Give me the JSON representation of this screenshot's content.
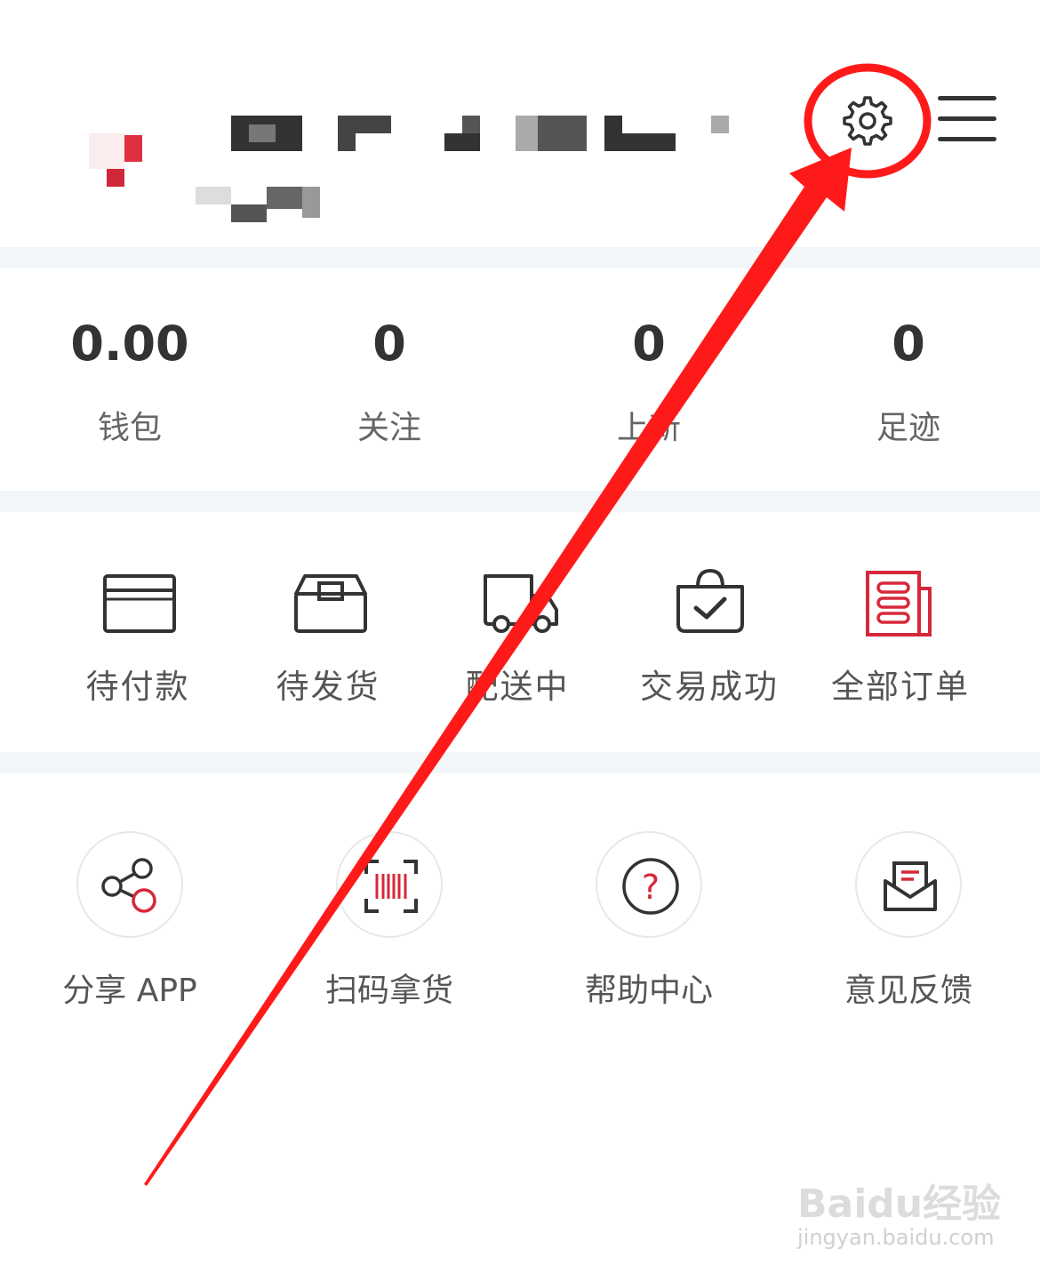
{
  "header": {
    "settings_icon": "gear-icon",
    "menu_icon": "hamburger-menu-icon"
  },
  "stats": [
    {
      "value": "0.00",
      "label": "钱包"
    },
    {
      "value": "0",
      "label": "关注"
    },
    {
      "value": "0",
      "label": "上新"
    },
    {
      "value": "0",
      "label": "足迹"
    }
  ],
  "orders": [
    {
      "label": "待付款",
      "icon": "card-icon"
    },
    {
      "label": "待发货",
      "icon": "box-icon"
    },
    {
      "label": "配送中",
      "icon": "truck-icon"
    },
    {
      "label": "交易成功",
      "icon": "bag-check-icon"
    },
    {
      "label": "全部订单",
      "icon": "order-list-icon"
    }
  ],
  "tools": [
    {
      "label": "分享 APP",
      "icon": "share-icon"
    },
    {
      "label": "扫码拿货",
      "icon": "barcode-scan-icon"
    },
    {
      "label": "帮助中心",
      "icon": "help-icon"
    },
    {
      "label": "意见反馈",
      "icon": "feedback-mail-icon"
    }
  ],
  "watermark": {
    "main": "Baidu经验",
    "sub": "jingyan.baidu.com"
  },
  "colors": {
    "accent_red": "#d6283a",
    "annotation_red": "#ff1a1a",
    "separator": "#f3f6f8",
    "text_dark": "#333333",
    "text_label": "#666666"
  }
}
